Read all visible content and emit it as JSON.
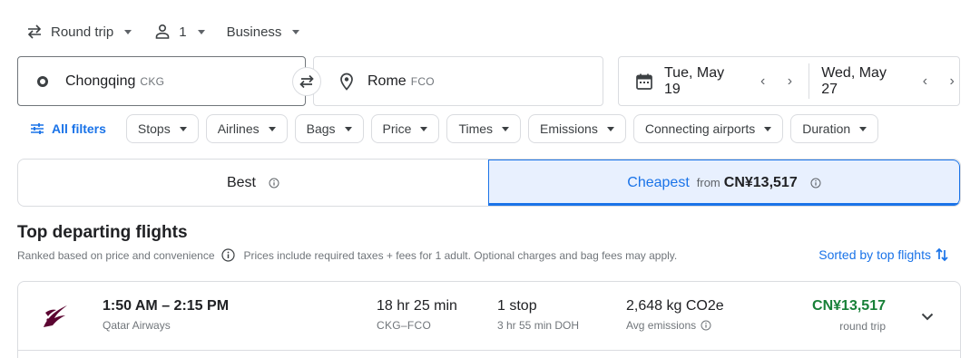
{
  "search": {
    "trip_type": "Round trip",
    "passengers": "1",
    "cabin": "Business",
    "origin_city": "Chongqing",
    "origin_code": "CKG",
    "destination_city": "Rome",
    "destination_code": "FCO",
    "depart_date": "Tue, May 19",
    "return_date": "Wed, May 27"
  },
  "filters": {
    "all_filters_label": "All filters",
    "chips": [
      "Stops",
      "Airlines",
      "Bags",
      "Price",
      "Times",
      "Emissions",
      "Connecting airports",
      "Duration"
    ]
  },
  "sort_tabs": {
    "best_label": "Best",
    "cheapest_label": "Cheapest",
    "cheapest_from": "from",
    "cheapest_price": "CN¥13,517"
  },
  "results": {
    "heading": "Top departing flights",
    "ranked_note": "Ranked based on price and convenience",
    "price_note": "Prices include required taxes + fees for 1 adult. Optional charges and bag fees may apply.",
    "sorted_label": "Sorted by top flights",
    "flights": [
      {
        "times": "1:50 AM – 2:15 PM",
        "airline": "Qatar Airways",
        "duration": "18 hr 25 min",
        "route": "CKG–FCO",
        "stops": "1 stop",
        "layover": "3 hr 55 min DOH",
        "emissions": "2,648 kg CO2e",
        "emissions_note": "Avg emissions",
        "price": "CN¥13,517",
        "price_type": "round trip"
      }
    ]
  },
  "colors": {
    "accent": "#1a73e8",
    "price_green": "#188038",
    "qatar_maroon": "#5c0632"
  }
}
